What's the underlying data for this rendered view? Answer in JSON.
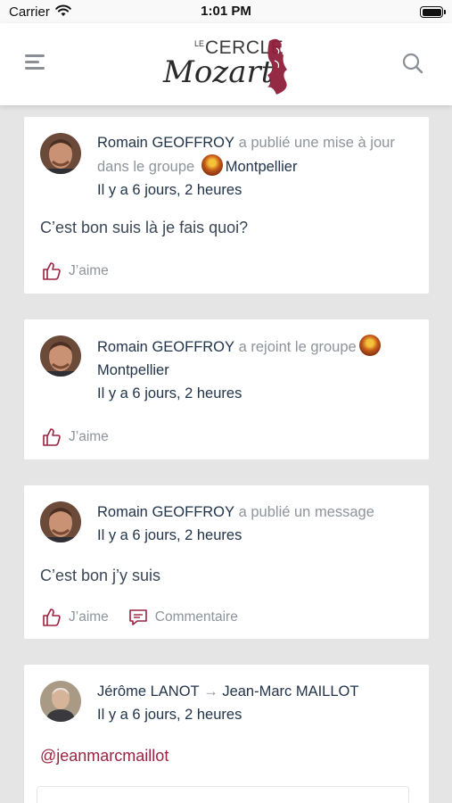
{
  "status_bar": {
    "carrier": "Carrier",
    "time": "1:01 PM"
  },
  "header": {
    "logo_text_top": "LE CERCLE",
    "logo_text_script": "Mozart"
  },
  "colors": {
    "accent": "#9b2340",
    "name": "#22344a",
    "muted": "#8e949b",
    "background": "#e5e5e5"
  },
  "posts": [
    {
      "author": "Romain GEOFFROY",
      "action": "a publié une mise à jour dans le groupe",
      "group": "Montpellier",
      "time": "Il y a 6 jours, 2 heures",
      "text": "C’est bon suis là je fais quoi?",
      "like_label": "J’aime"
    },
    {
      "author": "Romain GEOFFROY",
      "action": "a rejoint le groupe",
      "group": "Montpellier",
      "time": "Il y a 6 jours, 2 heures",
      "like_label": "J’aime"
    },
    {
      "author": "Romain GEOFFROY",
      "action": "a publié un message",
      "time": "Il y a 6 jours, 2 heures",
      "text": "C’est bon j’y suis",
      "like_label": "J’aime",
      "comment_label": "Commentaire"
    },
    {
      "author": "Jérôme LANOT",
      "arrow": "→",
      "recipient": "Jean-Marc MAILLOT",
      "time": "Il y a 6 jours, 2 heures",
      "text": "@jeanmarcmaillot"
    }
  ]
}
